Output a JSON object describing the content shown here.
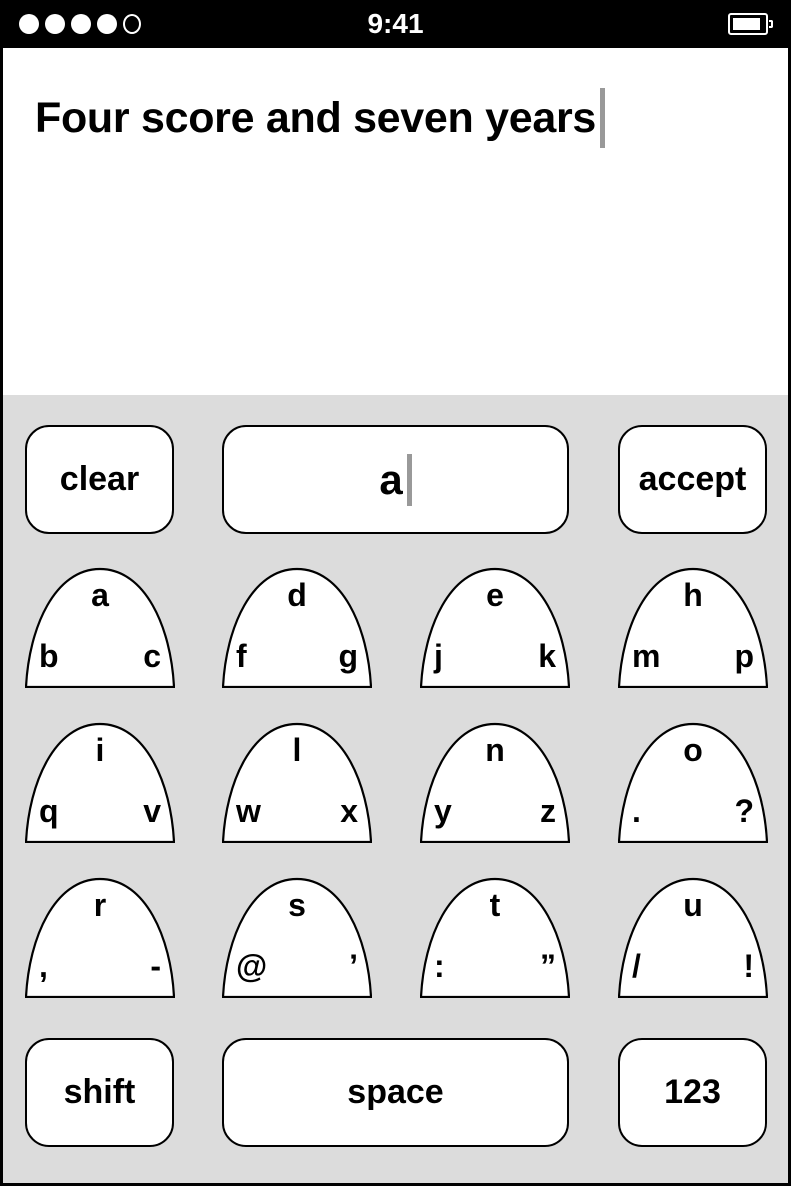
{
  "status_bar": {
    "signal_bars_filled": 4,
    "signal_bars_total": 5,
    "time": "9:41",
    "battery_icon": "battery-icon"
  },
  "document": {
    "text": "Four score and seven years"
  },
  "keyboard": {
    "clear_label": "clear",
    "entry_value": "a",
    "accept_label": "accept",
    "keys": [
      {
        "top": "a",
        "left": "b",
        "right": "c"
      },
      {
        "top": "d",
        "left": "f",
        "right": "g"
      },
      {
        "top": "e",
        "left": "j",
        "right": "k"
      },
      {
        "top": "h",
        "left": "m",
        "right": "p"
      },
      {
        "top": "i",
        "left": "q",
        "right": "v"
      },
      {
        "top": "l",
        "left": "w",
        "right": "x"
      },
      {
        "top": "n",
        "left": "y",
        "right": "z"
      },
      {
        "top": "o",
        "left": ".",
        "right": "?"
      },
      {
        "top": "r",
        "left": ",",
        "right": "-"
      },
      {
        "top": "s",
        "left": "@",
        "right": "’"
      },
      {
        "top": "t",
        "left": ":",
        "right": "”"
      },
      {
        "top": "u",
        "left": "/",
        "right": "!"
      }
    ],
    "shift_label": "shift",
    "space_label": "space",
    "numbers_label": "123"
  },
  "colors": {
    "keyboard_background": "#dcdcdc",
    "caret": "#999999"
  }
}
